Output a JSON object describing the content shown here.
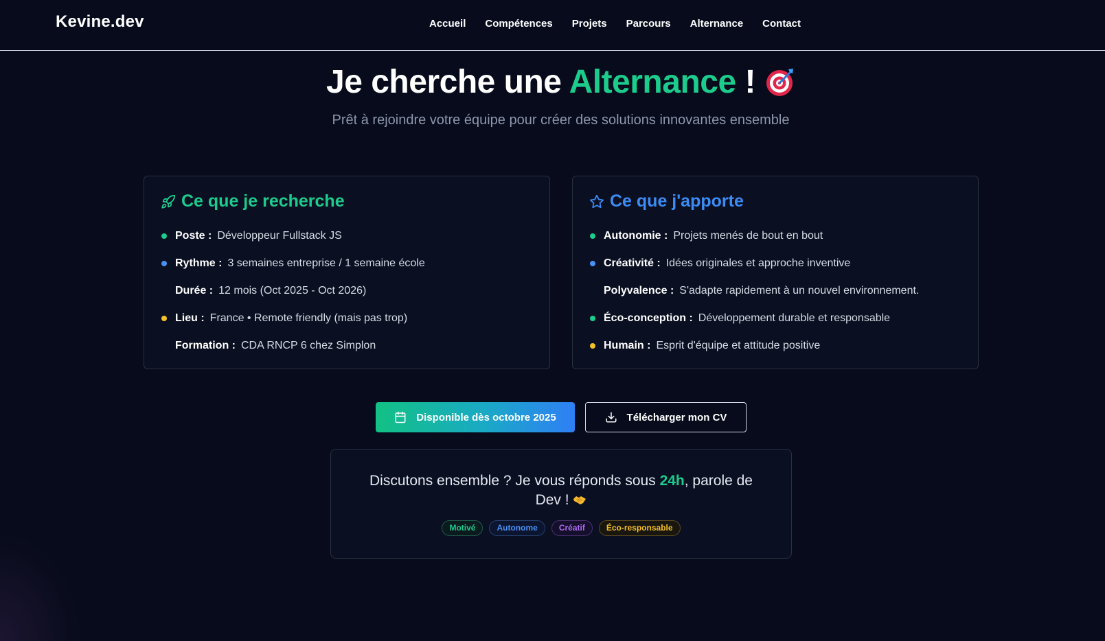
{
  "nav": {
    "logo": "Kevine.dev",
    "links": [
      "Accueil",
      "Compétences",
      "Projets",
      "Parcours",
      "Alternance",
      "Contact"
    ]
  },
  "hero": {
    "title_prefix": "Je cherche une ",
    "title_accent": "Alternance",
    "title_suffix": " !",
    "title_icon": "target-emoji",
    "subtitle": "Prêt à rejoindre votre équipe pour créer des solutions innovantes ensemble"
  },
  "card_left": {
    "icon": "rocket-icon",
    "title": "Ce que je recherche",
    "rows": [
      {
        "key": "Poste :",
        "value": "Développeur Fullstack JS",
        "dot": "#1ccc8d"
      },
      {
        "key": "Rythme :",
        "value": "3 semaines entreprise / 1 semaine école",
        "dot": "#4a90f5"
      },
      {
        "key": "Durée :",
        "value": "12 mois (Oct 2025 - Oct 2026)",
        "dot": ""
      },
      {
        "key": "Lieu :",
        "value": "France • Remote friendly (mais pas trop)",
        "dot": "#f5c026"
      },
      {
        "key": "Formation :",
        "value": "CDA RNCP 6 chez Simplon",
        "dot": ""
      }
    ]
  },
  "card_right": {
    "icon": "star-icon",
    "title": "Ce que j'apporte",
    "rows": [
      {
        "key": "Autonomie :",
        "value": "Projets menés de bout en bout",
        "dot": "#1ccc8d"
      },
      {
        "key": "Créativité :",
        "value": "Idées originales et approche inventive",
        "dot": "#4a90f5"
      },
      {
        "key": "Polyvalence :",
        "value": "S'adapte rapidement à un nouvel environnement.",
        "dot": ""
      },
      {
        "key": "Éco-conception :",
        "value": "Développement durable et responsable",
        "dot": "#1ccc8d"
      },
      {
        "key": "Humain :",
        "value": "Esprit d'équipe et attitude positive",
        "dot": "#f5c026"
      }
    ]
  },
  "buttons": {
    "available": "Disponible dès octobre 2025",
    "download_cv": "Télécharger mon CV"
  },
  "cta": {
    "text_before": "Discutons ensemble ? Je vous réponds sous ",
    "text_accent": "24h",
    "text_after": ", parole de Dev ! ",
    "icon": "handshake-emoji",
    "tags": [
      {
        "label": "Motivé",
        "color": "green"
      },
      {
        "label": "Autonome",
        "color": "blue"
      },
      {
        "label": "Créatif",
        "color": "purple"
      },
      {
        "label": "Éco-responsable",
        "color": "yellow"
      }
    ]
  },
  "colors": {
    "background": "#070b1b",
    "accent_green": "#1ccc8d",
    "accent_blue": "#3b8cf5",
    "accent_yellow": "#f5c026",
    "accent_purple": "#b06cf5"
  }
}
